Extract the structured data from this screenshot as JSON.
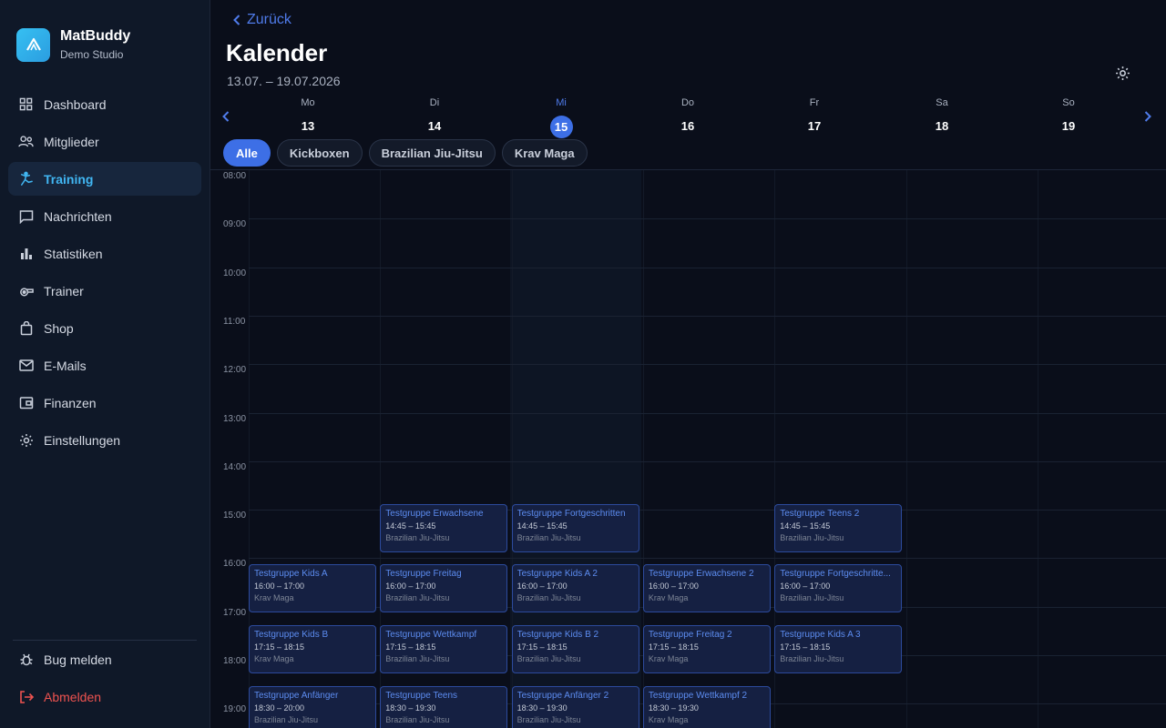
{
  "brand": {
    "name": "MatBuddy",
    "subtitle": "Demo Studio"
  },
  "sidebar": {
    "items": [
      {
        "label": "Dashboard",
        "icon": "grid-icon"
      },
      {
        "label": "Mitglieder",
        "icon": "users-icon"
      },
      {
        "label": "Training",
        "icon": "martial-arts-icon",
        "active": true
      },
      {
        "label": "Nachrichten",
        "icon": "chat-icon"
      },
      {
        "label": "Statistiken",
        "icon": "bar-chart-icon"
      },
      {
        "label": "Trainer",
        "icon": "whistle-icon"
      },
      {
        "label": "Shop",
        "icon": "shopping-bag-icon"
      },
      {
        "label": "E-Mails",
        "icon": "mail-icon"
      },
      {
        "label": "Finanzen",
        "icon": "wallet-icon"
      },
      {
        "label": "Einstellungen",
        "icon": "gear-icon"
      }
    ],
    "bottom": [
      {
        "label": "Bug melden",
        "icon": "bug-icon"
      },
      {
        "label": "Abmelden",
        "icon": "logout-icon"
      }
    ]
  },
  "header": {
    "back_label": "Zurück",
    "title": "Kalender",
    "range": "13.07. – 19.07.2026"
  },
  "days": [
    {
      "name": "Mo",
      "date": "13"
    },
    {
      "name": "Di",
      "date": "14"
    },
    {
      "name": "Mi",
      "date": "15",
      "today": true
    },
    {
      "name": "Do",
      "date": "16"
    },
    {
      "name": "Fr",
      "date": "17"
    },
    {
      "name": "Sa",
      "date": "18"
    },
    {
      "name": "So",
      "date": "19"
    }
  ],
  "filters": [
    "Alle",
    "Kickboxen",
    "Brazilian Jiu-Jitsu",
    "Krav Maga"
  ],
  "active_filter": "Alle",
  "hours": [
    "08:00",
    "09:00",
    "10:00",
    "11:00",
    "12:00",
    "13:00",
    "14:00",
    "15:00",
    "16:00",
    "17:00",
    "18:00",
    "19:00"
  ],
  "events": [
    {
      "day": 1,
      "title": "Testgruppe Erwachsene",
      "time": "14:45 – 15:45",
      "discipline": "Brazilian Jiu-Jitsu"
    },
    {
      "day": 2,
      "title": "Testgruppe Fortgeschritten",
      "time": "14:45 – 15:45",
      "discipline": "Brazilian Jiu-Jitsu"
    },
    {
      "day": 4,
      "title": "Testgruppe Teens 2",
      "time": "14:45 – 15:45",
      "discipline": "Brazilian Jiu-Jitsu"
    },
    {
      "day": 0,
      "title": "Testgruppe Kids A",
      "time": "16:00 – 17:00",
      "discipline": "Krav Maga"
    },
    {
      "day": 1,
      "title": "Testgruppe Freitag",
      "time": "16:00 – 17:00",
      "discipline": "Brazilian Jiu-Jitsu"
    },
    {
      "day": 2,
      "title": "Testgruppe Kids A 2",
      "time": "16:00 – 17:00",
      "discipline": "Brazilian Jiu-Jitsu"
    },
    {
      "day": 3,
      "title": "Testgruppe Erwachsene 2",
      "time": "16:00 – 17:00",
      "discipline": "Krav Maga"
    },
    {
      "day": 4,
      "title": "Testgruppe Fortgeschritte...",
      "time": "16:00 – 17:00",
      "discipline": "Brazilian Jiu-Jitsu"
    },
    {
      "day": 0,
      "title": "Testgruppe Kids B",
      "time": "17:15 – 18:15",
      "discipline": "Krav Maga"
    },
    {
      "day": 1,
      "title": "Testgruppe Wettkampf",
      "time": "17:15 – 18:15",
      "discipline": "Brazilian Jiu-Jitsu"
    },
    {
      "day": 2,
      "title": "Testgruppe Kids B 2",
      "time": "17:15 – 18:15",
      "discipline": "Brazilian Jiu-Jitsu"
    },
    {
      "day": 3,
      "title": "Testgruppe Freitag 2",
      "time": "17:15 – 18:15",
      "discipline": "Krav Maga"
    },
    {
      "day": 4,
      "title": "Testgruppe Kids A 3",
      "time": "17:15 – 18:15",
      "discipline": "Brazilian Jiu-Jitsu"
    },
    {
      "day": 0,
      "title": "Testgruppe Anfänger",
      "time": "18:30 – 20:00",
      "discipline": "Brazilian Jiu-Jitsu"
    },
    {
      "day": 1,
      "title": "Testgruppe Teens",
      "time": "18:30 – 19:30",
      "discipline": "Brazilian Jiu-Jitsu"
    },
    {
      "day": 2,
      "title": "Testgruppe Anfänger 2",
      "time": "18:30 – 19:30",
      "discipline": "Brazilian Jiu-Jitsu"
    },
    {
      "day": 3,
      "title": "Testgruppe Wettkampf 2",
      "time": "18:30 – 19:30",
      "discipline": "Krav Maga"
    }
  ]
}
